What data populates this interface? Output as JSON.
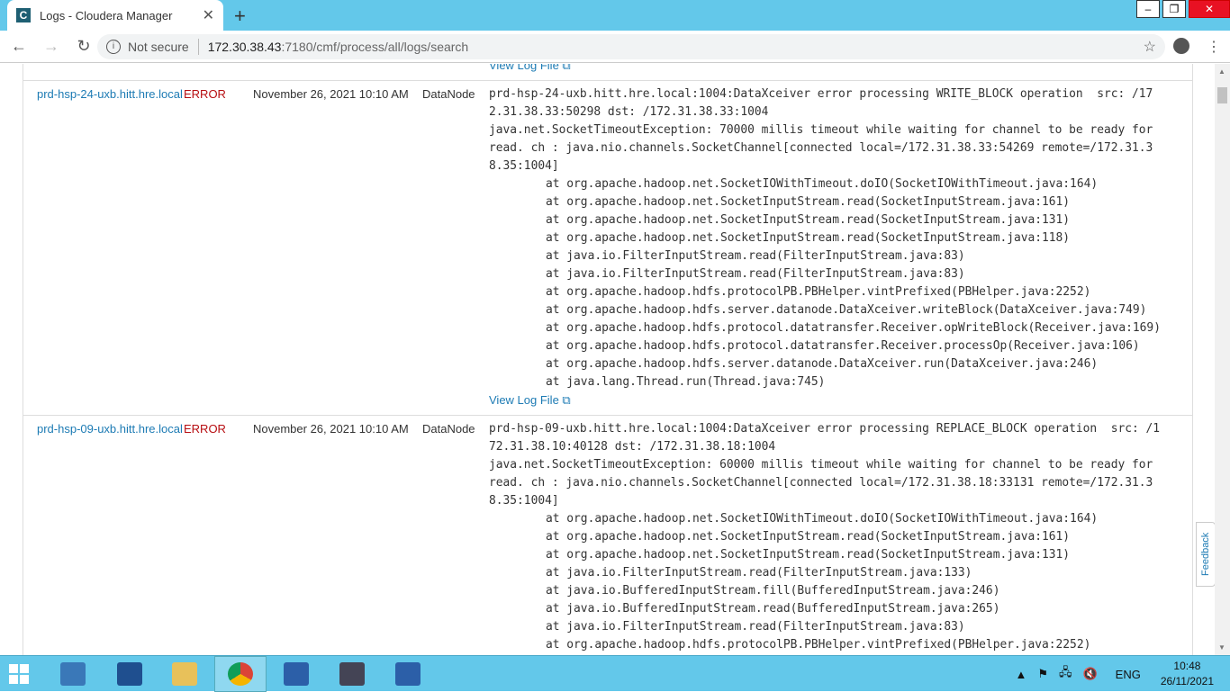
{
  "browser": {
    "tab_title": "Logs - Cloudera Manager",
    "favicon_letter": "C",
    "security_label": "Not secure",
    "url_host": "172.30.38.43",
    "url_path": ":7180/cmf/process/all/logs/search"
  },
  "view_log_label": "View Log File",
  "rows": [
    {
      "host": "prd-hsp-24-uxb.hitt.hre.local",
      "level": "ERROR",
      "date": "November 26, 2021 10:10 AM",
      "role": "DataNode",
      "message": "prd-hsp-24-uxb.hitt.hre.local:1004:DataXceiver error processing WRITE_BLOCK operation  src: /172.31.38.33:50298 dst: /172.31.38.33:1004\njava.net.SocketTimeoutException: 70000 millis timeout while waiting for channel to be ready for read. ch : java.nio.channels.SocketChannel[connected local=/172.31.38.33:54269 remote=/172.31.38.35:1004]",
      "stack": [
        "at org.apache.hadoop.net.SocketIOWithTimeout.doIO(SocketIOWithTimeout.java:164)",
        "at org.apache.hadoop.net.SocketInputStream.read(SocketInputStream.java:161)",
        "at org.apache.hadoop.net.SocketInputStream.read(SocketInputStream.java:131)",
        "at org.apache.hadoop.net.SocketInputStream.read(SocketInputStream.java:118)",
        "at java.io.FilterInputStream.read(FilterInputStream.java:83)",
        "at java.io.FilterInputStream.read(FilterInputStream.java:83)",
        "at org.apache.hadoop.hdfs.protocolPB.PBHelper.vintPrefixed(PBHelper.java:2252)",
        "at org.apache.hadoop.hdfs.server.datanode.DataXceiver.writeBlock(DataXceiver.java:749)",
        "at org.apache.hadoop.hdfs.protocol.datatransfer.Receiver.opWriteBlock(Receiver.java:169)",
        "at org.apache.hadoop.hdfs.protocol.datatransfer.Receiver.processOp(Receiver.java:106)",
        "at org.apache.hadoop.hdfs.server.datanode.DataXceiver.run(DataXceiver.java:246)",
        "at java.lang.Thread.run(Thread.java:745)"
      ]
    },
    {
      "host": "prd-hsp-09-uxb.hitt.hre.local",
      "level": "ERROR",
      "date": "November 26, 2021 10:10 AM",
      "role": "DataNode",
      "message": "prd-hsp-09-uxb.hitt.hre.local:1004:DataXceiver error processing REPLACE_BLOCK operation  src: /172.31.38.10:40128 dst: /172.31.38.18:1004\njava.net.SocketTimeoutException: 60000 millis timeout while waiting for channel to be ready for read. ch : java.nio.channels.SocketChannel[connected local=/172.31.38.18:33131 remote=/172.31.38.35:1004]",
      "stack": [
        "at org.apache.hadoop.net.SocketIOWithTimeout.doIO(SocketIOWithTimeout.java:164)",
        "at org.apache.hadoop.net.SocketInputStream.read(SocketInputStream.java:161)",
        "at org.apache.hadoop.net.SocketInputStream.read(SocketInputStream.java:131)",
        "at java.io.FilterInputStream.read(FilterInputStream.java:133)",
        "at java.io.BufferedInputStream.fill(BufferedInputStream.java:246)",
        "at java.io.BufferedInputStream.read(BufferedInputStream.java:265)",
        "at java.io.FilterInputStream.read(FilterInputStream.java:83)",
        "at org.apache.hadoop.hdfs.protocolPB.PBHelper.vintPrefixed(PBHelper.java:2252)"
      ]
    }
  ],
  "feedback_label": "Feedback",
  "tray": {
    "language": "ENG",
    "time": "10:48",
    "date": "26/11/2021"
  }
}
